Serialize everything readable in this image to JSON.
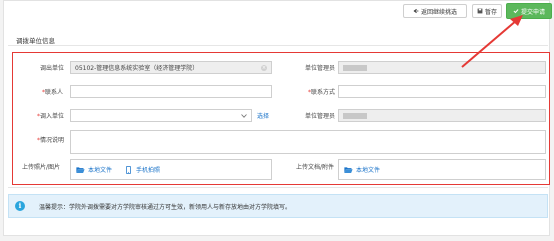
{
  "toolbar": {
    "back_label": "返回继续挑选",
    "save_label": "暂存",
    "submit_label": "提交申请"
  },
  "section": {
    "title": "调拨单位信息"
  },
  "form": {
    "out_unit": {
      "label": "调出单位",
      "value": "05102-管理信息系统实验室（经济管理学院）"
    },
    "out_manager": {
      "label": "单位管理员"
    },
    "contact_person": {
      "label": "联系人",
      "value": ""
    },
    "contact_method": {
      "label": "联系方式",
      "value": ""
    },
    "in_unit": {
      "label": "调入单位",
      "value": "",
      "select_label": "选择"
    },
    "in_manager": {
      "label": "单位管理员"
    },
    "description": {
      "label": "情况说明",
      "value": ""
    },
    "upload_photo": {
      "label": "上传照片/图片",
      "local_file": "本地文件",
      "mobile_photo": "手机拍照"
    },
    "upload_doc": {
      "label": "上传文档/附件",
      "local_file": "本地文件"
    }
  },
  "notice": {
    "text": "温馨提示：学院外调拨需要对方学院审核通过方可生效，新领用人与新存放地由对方学院填写。"
  },
  "colors": {
    "submit": "#5cb85c",
    "highlight": "#e53935",
    "link": "#1a73c9",
    "info_bg": "#e3f1fb"
  }
}
